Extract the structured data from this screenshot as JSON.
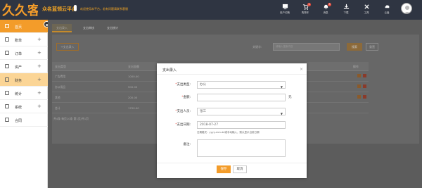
{
  "header": {
    "brand": "众名蓝领云平台",
    "notice": "欢迎使用本平台，若有问题请联系客服",
    "items": [
      {
        "label": "用户切换",
        "icon": "switch-user-icon",
        "badge": ""
      },
      {
        "label": "购物车",
        "icon": "cart-icon",
        "badge": "1"
      },
      {
        "label": "消息",
        "icon": "bell-icon",
        "badge": "3"
      },
      {
        "label": "下载",
        "icon": "download-icon",
        "badge": ""
      },
      {
        "label": "工具",
        "icon": "tools-icon",
        "badge": ""
      },
      {
        "label": "云盘",
        "icon": "cloud-icon",
        "badge": ""
      }
    ],
    "avatar": "user-avatar"
  },
  "sidebar": {
    "items": [
      {
        "label": "首页",
        "icon": "home-icon",
        "plus": ""
      },
      {
        "label": "账单",
        "icon": "bill-icon",
        "plus": "+"
      },
      {
        "label": "订单",
        "icon": "order-icon",
        "plus": "+"
      },
      {
        "label": "资产",
        "icon": "asset-icon",
        "plus": "+"
      },
      {
        "label": "财务",
        "icon": "finance-icon",
        "plus": "+"
      },
      {
        "label": "统计",
        "icon": "chart-icon",
        "plus": "+"
      },
      {
        "label": "系统",
        "icon": "settings-icon",
        "plus": "+"
      },
      {
        "label": "合同",
        "icon": "contract-icon",
        "plus": ""
      }
    ]
  },
  "main": {
    "tabs": [
      "支出录入",
      "支出审核",
      "支出统计"
    ],
    "add_button": "+支出录入",
    "search_label": "关键字:",
    "search_placeholder": "请输入搜索内容",
    "search_button": "搜索",
    "reset_button": "重置",
    "columns": [
      "支出类型",
      "支出金额",
      "",
      "",
      "",
      "操作"
    ],
    "rows": [
      [
        "广告费用",
        "1000.00"
      ],
      [
        "办公用品",
        "500.00"
      ],
      [
        "其他",
        "200.00"
      ],
      [
        "合计",
        "1700.00"
      ]
    ],
    "pager": "共4条  每页10条  第1页/共1页"
  },
  "modal": {
    "title": "支出录入",
    "fields": {
      "type_label": "支出类型:",
      "type_value": "办公",
      "amount_label": "金额:",
      "amount_value": "",
      "amount_unit": "元",
      "person_label": "支出人员:",
      "person_value": "张三",
      "date_label": "支出日期:",
      "date_value": "2018-07-27",
      "date_hint": "日期格式：yyyy-mm-dd或手动输入，默认显示当前日期",
      "note_label": "备注:",
      "note_value": ""
    },
    "save_button": "保存",
    "cancel_button": "取消"
  }
}
